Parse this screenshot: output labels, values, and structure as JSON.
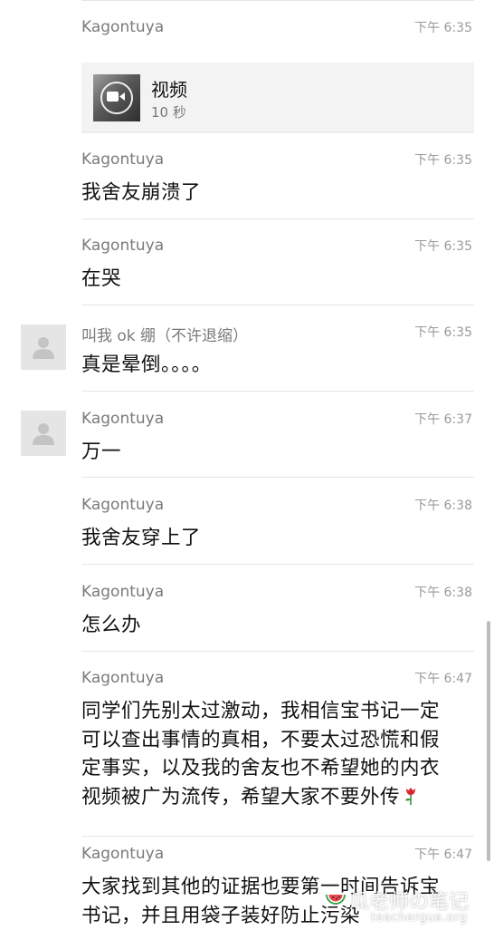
{
  "messages": [
    {
      "sender": "Kagontuya",
      "time": "下午 6:35",
      "type": "video",
      "video": {
        "title": "视频",
        "duration": "10 秒"
      }
    },
    {
      "sender": "Kagontuya",
      "time": "下午 6:35",
      "text": "我舍友崩溃了"
    },
    {
      "sender": "Kagontuya",
      "time": "下午 6:35",
      "text": "在哭"
    },
    {
      "sender": "叫我 ok 绷（不许退缩）",
      "time": "下午 6:35",
      "text": "真是晕倒。。。。",
      "avatar": "default-avatar-icon"
    },
    {
      "sender": "Kagontuya",
      "time": "下午 6:37",
      "text": "万一",
      "avatar": "default-avatar-icon"
    },
    {
      "sender": "Kagontuya",
      "time": "下午 6:38",
      "text": "我舍友穿上了"
    },
    {
      "sender": "Kagontuya",
      "time": "下午 6:38",
      "text": "怎么办"
    },
    {
      "sender": "Kagontuya",
      "time": "下午 6:47",
      "lines": [
        "同学们先别太过激动，我相信宝书记一定",
        "可以查出事情的真相，不要太过恐慌和假",
        "定事实，以及我的舍友也不希望她的内衣",
        "视频被广为流传，希望大家不要外传"
      ],
      "emoji": "rose-icon"
    },
    {
      "sender": "Kagontuya",
      "time": "下午 6:47",
      "lines": [
        "大家找到其他的证据也要第一时间告诉宝",
        "书记，并且用袋子装好防止污染"
      ]
    }
  ],
  "watermark": {
    "text": "瓜老师の笔记",
    "url": "teachergua.org"
  },
  "colors": {
    "background": "#ffffff",
    "card": "#f3f3f3",
    "sender": "#7a7a7a",
    "time": "#9a9a9a",
    "text": "#111111",
    "rose": "#d8282c"
  }
}
